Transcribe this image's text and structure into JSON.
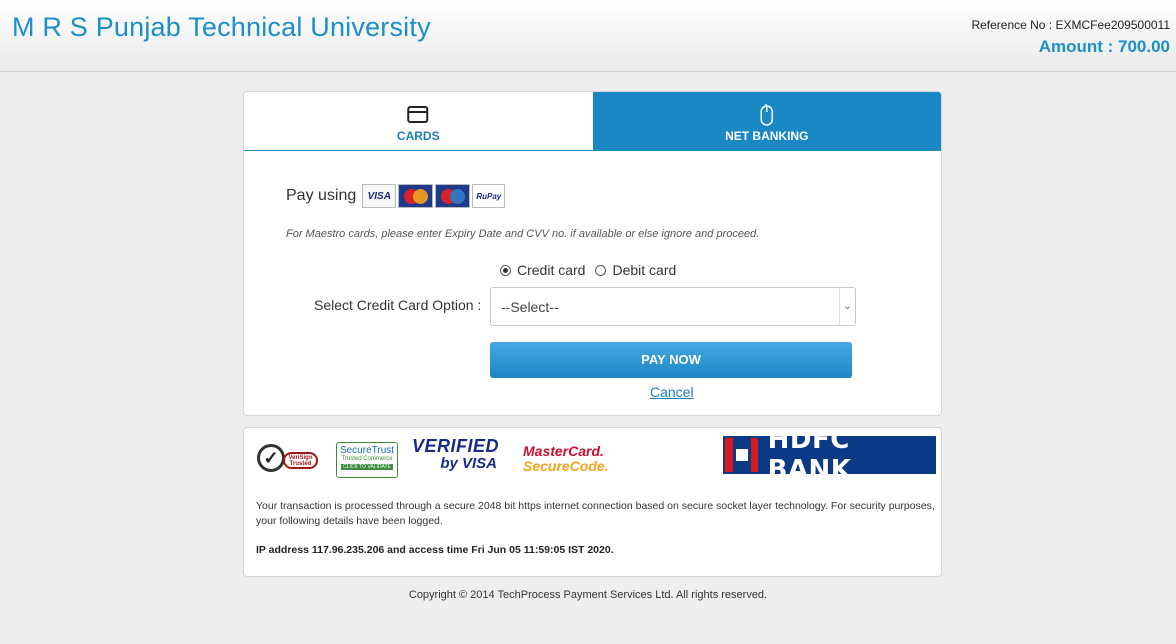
{
  "header": {
    "university": "M R S Punjab Technical University",
    "reference": "Reference No : EXMCFee209500011",
    "amount": "Amount : 700.00"
  },
  "tabs": [
    {
      "label": "CARDS",
      "icon": "credit-card-icon",
      "active": true
    },
    {
      "label": "NET BANKING",
      "icon": "mouse-icon",
      "active": false
    }
  ],
  "payment": {
    "pay_using": "Pay using",
    "card_logos": [
      "VISA",
      "MasterCard",
      "Maestro",
      "RuPay"
    ],
    "maestro_note": "For Maestro cards, please enter Expiry Date and CVV no. if available or else ignore and proceed.",
    "card_types": [
      {
        "label": "Credit card",
        "checked": true
      },
      {
        "label": "Debit card",
        "checked": false
      }
    ],
    "select_label": "Select Credit Card Option :",
    "select_value": "--Select--",
    "pay_now": "PAY NOW",
    "cancel": "Cancel"
  },
  "trust": {
    "verisign": "VeriSign Trusted",
    "securetrust": [
      "SecureTrust",
      "Trusted Commerce",
      "CLICK TO VALIDATE"
    ],
    "verified_by_visa": [
      "VERIFIED",
      "by VISA"
    ],
    "mastercard_securecode": [
      "MasterCard.",
      "SecureCode."
    ],
    "bank": "HDFC BANK",
    "secure_text": "Your transaction is processed through a secure 2048 bit https internet connection based on secure socket layer technology. For security purposes, your following details have been logged.",
    "ip_text": "IP address 117.96.235.206 and access time Fri Jun 05 11:59:05 IST 2020."
  },
  "footer": {
    "copyright": "Copyright © 2014 TechProcess Payment Services Ltd. All rights reserved."
  },
  "colors": {
    "brand_blue": "#1b8fc8",
    "tab_active_bg": "#1b88c6",
    "hdfc_blue": "#0a3a86",
    "hdfc_red": "#d71920"
  }
}
